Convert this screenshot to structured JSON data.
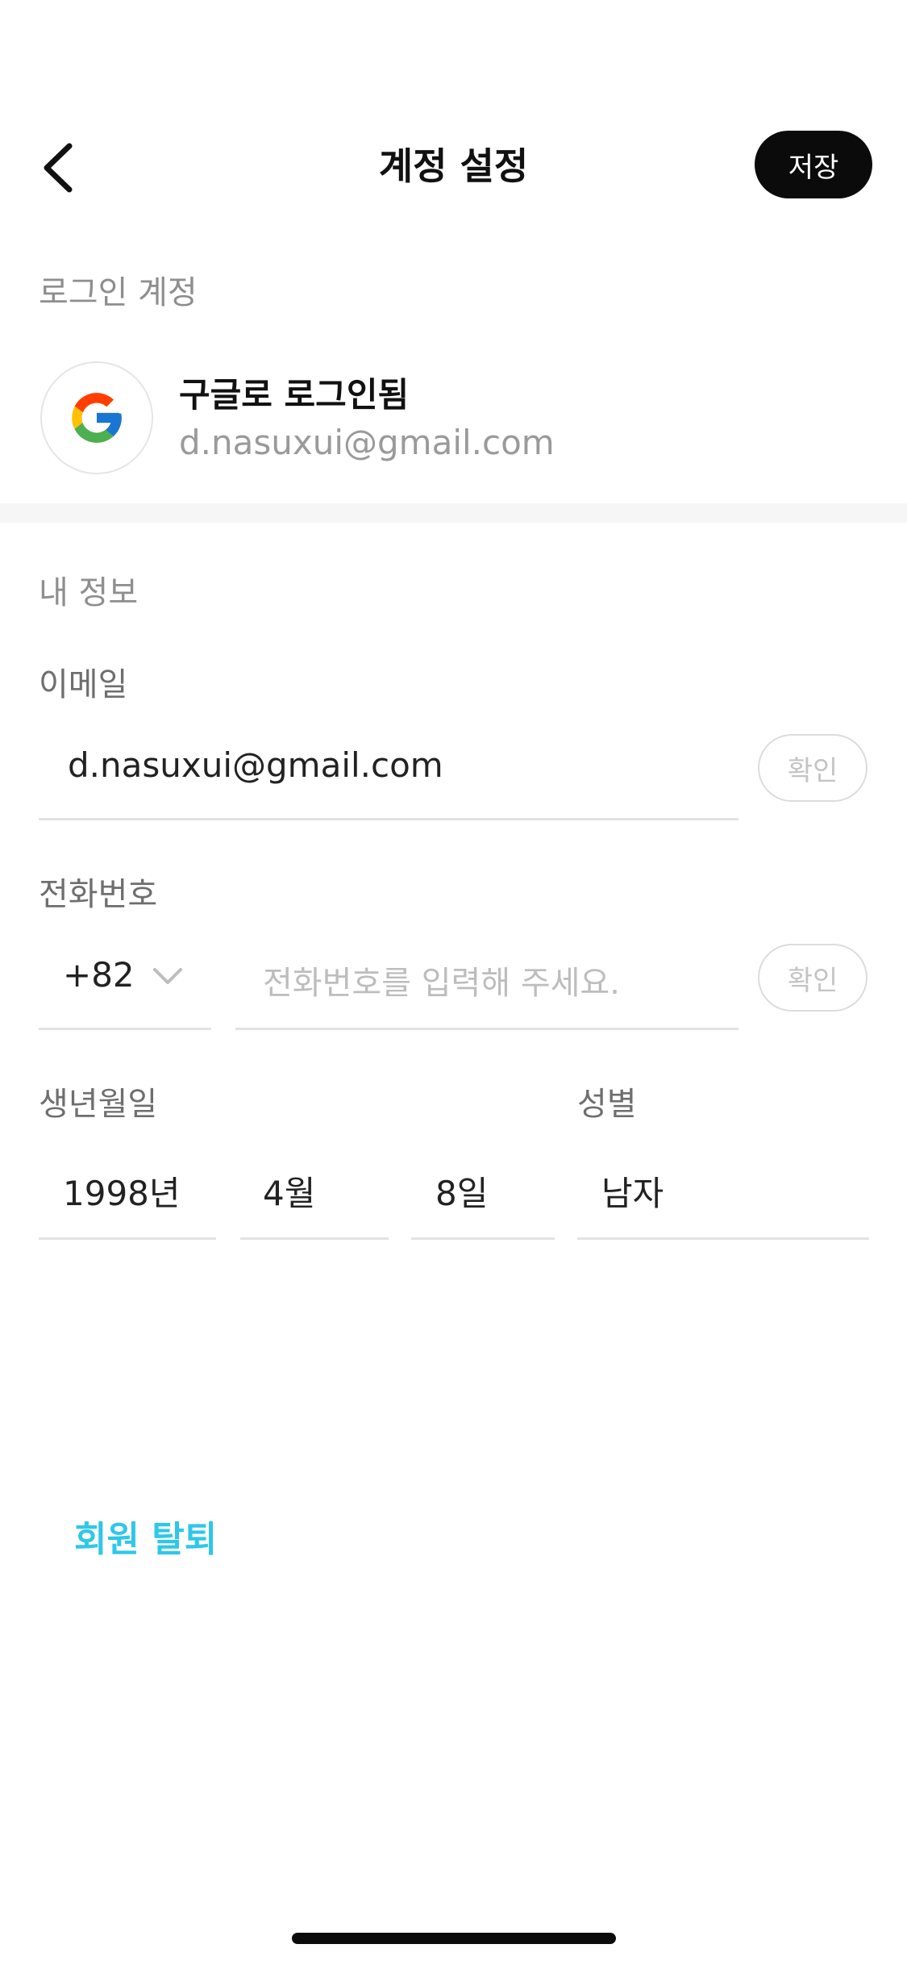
{
  "header": {
    "title": "계정 설정",
    "save_label": "저장"
  },
  "login_section": {
    "label": "로그인 계정",
    "status": "구글로 로그인됨",
    "email": "d.nasuxui@gmail.com"
  },
  "info_section": {
    "label": "내 정보",
    "email": {
      "label": "이메일",
      "value": "d.nasuxui@gmail.com",
      "confirm_label": "확인"
    },
    "phone": {
      "label": "전화번호",
      "country_code": "+82",
      "placeholder": "전화번호를 입력해 주세요.",
      "confirm_label": "확인"
    },
    "birthday": {
      "label": "생년월일",
      "year": "1998년",
      "month": "4월",
      "day": "8일"
    },
    "gender": {
      "label": "성별",
      "value": "남자"
    }
  },
  "withdraw_label": "회원 탈퇴",
  "colors": {
    "accent": "#2ec7ea",
    "save_button": "#0b0b0b"
  }
}
